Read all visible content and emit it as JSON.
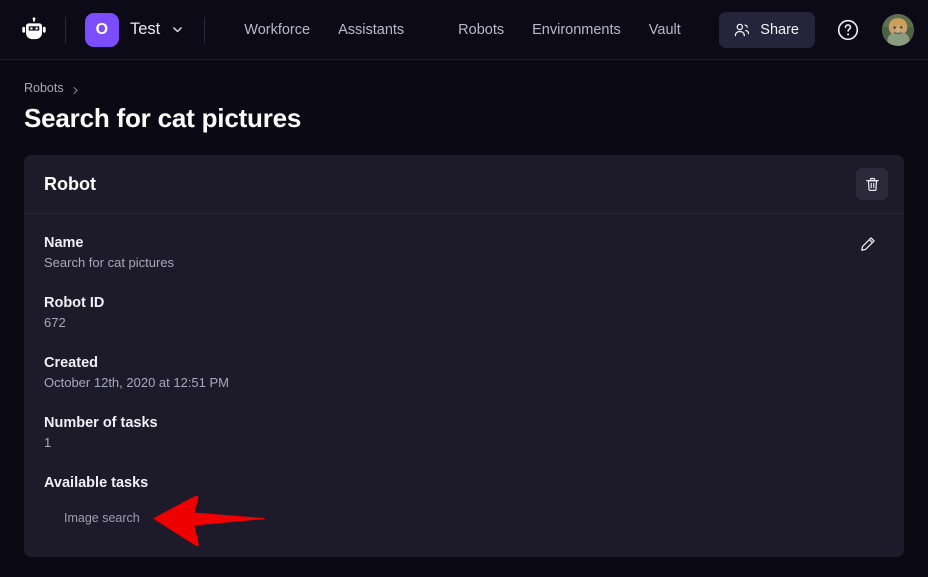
{
  "header": {
    "logo_icon": "robot-head-icon",
    "org": {
      "badge_letter": "O",
      "name": "Test",
      "chevron_icon": "chevron-down-icon"
    },
    "nav": [
      {
        "label": "Workforce"
      },
      {
        "label": "Assistants"
      },
      {
        "label": "Robots"
      },
      {
        "label": "Environments"
      },
      {
        "label": "Vault"
      }
    ],
    "share": {
      "label": "Share",
      "icon": "people-icon"
    },
    "help": {
      "icon": "question-circle-icon"
    },
    "avatar": {
      "icon": "user-avatar"
    }
  },
  "breadcrumb": {
    "items": [
      {
        "label": "Robots"
      }
    ],
    "separator_icon": "chevron-right-icon"
  },
  "page": {
    "title": "Search for cat pictures"
  },
  "card": {
    "title": "Robot",
    "delete_icon": "trash-icon",
    "edit_icon": "pencil-icon",
    "fields": [
      {
        "label": "Name",
        "value": "Search for cat pictures"
      },
      {
        "label": "Robot ID",
        "value": "672"
      },
      {
        "label": "Created",
        "value": "October 12th, 2020 at 12:51 PM"
      },
      {
        "label": "Number of tasks",
        "value": "1"
      }
    ],
    "available_tasks": {
      "label": "Available tasks",
      "items": [
        {
          "label": "Image search"
        }
      ]
    }
  },
  "annotation": {
    "type": "arrow",
    "direction": "left",
    "color": "#ee0000",
    "points_at": "Image search"
  },
  "colors": {
    "page_bg": "#0b0914",
    "header_bg": "#0c0a17",
    "card_bg": "#1d1b2a",
    "accent_purple": "#7c4dff",
    "annotation_red": "#ee0000"
  }
}
